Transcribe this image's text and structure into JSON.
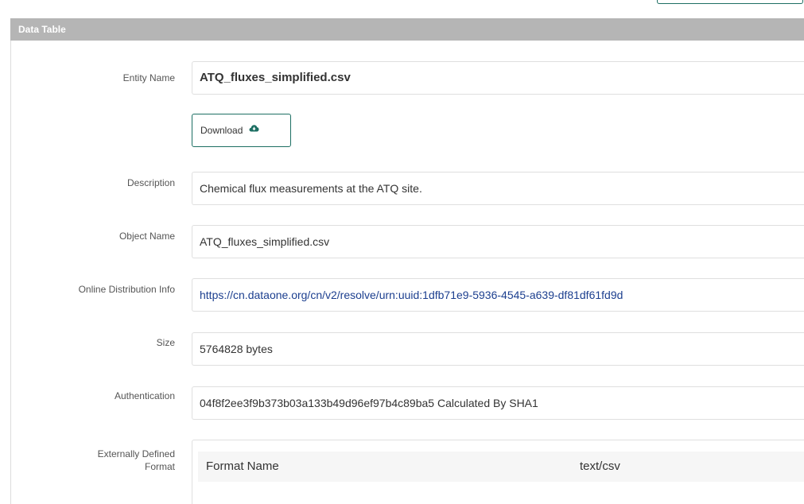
{
  "panel": {
    "title": "Data Table"
  },
  "download": {
    "label": "Download",
    "icon": "cloud-download-icon"
  },
  "fields": {
    "entity_name": {
      "label": "Entity Name",
      "value": "ATQ_fluxes_simplified.csv"
    },
    "description": {
      "label": "Description",
      "value": "Chemical flux measurements at the ATQ site."
    },
    "object_name": {
      "label": "Object Name",
      "value": "ATQ_fluxes_simplified.csv"
    },
    "online_distribution": {
      "label": "Online Distribution Info",
      "value": "https://cn.dataone.org/cn/v2/resolve/urn:uuid:1dfb71e9-5936-4545-a639-df81df61fd9d"
    },
    "size": {
      "label": "Size",
      "value": "5764828 bytes"
    },
    "authentication": {
      "label": "Authentication",
      "value": "04f8f2ee3f9b373b03a133b49d96ef97b4c89ba5 Calculated By SHA1"
    },
    "external_format": {
      "label_line1": "Externally Defined",
      "label_line2": "Format",
      "format_name_label": "Format Name",
      "format_name_value": "text/csv"
    }
  },
  "colors": {
    "header_bg": "#b5b5b5",
    "button_border": "#1d6f63",
    "link": "#1c3f8f"
  }
}
